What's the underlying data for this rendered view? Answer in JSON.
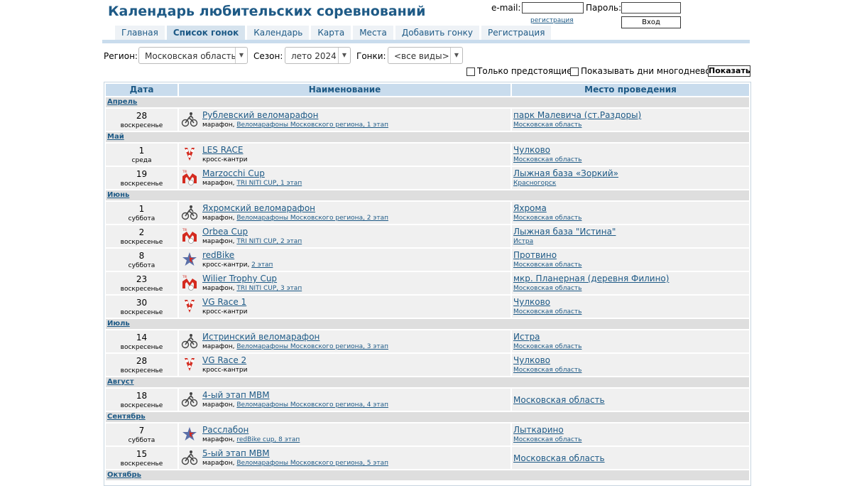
{
  "site": {
    "title": "Календарь любительских соревнований"
  },
  "login": {
    "email_label": "e-mail:",
    "password_label": "Пароль:",
    "register_link": "регистрация",
    "enter_button": "Вход"
  },
  "nav": {
    "tabs": [
      "Главная",
      "Список гонок",
      "Календарь",
      "Карта",
      "Места",
      "Добавить гонку",
      "Регистрация"
    ],
    "active": "Список гонок"
  },
  "filters": {
    "region_label": "Регион:",
    "region_value": "Московская область",
    "season_label": "Сезон:",
    "season_value": "лето 2024",
    "races_label": "Гонки:",
    "races_value": "<все виды>"
  },
  "options": {
    "upcoming_label": "Только предстоящие",
    "multiday_label": "Показывать дни многодневок",
    "show_button": "Показать"
  },
  "table": {
    "headers": {
      "date": "Дата",
      "name": "Наименование",
      "place": "Место проведения"
    },
    "months": [
      {
        "month": "Апрель",
        "races": [
          {
            "day": "28",
            "weekday": "воскресенье",
            "icon": "cyclist-icon",
            "name": "Рублевский веломарафон",
            "type": "марафон, ",
            "series": "Веломарафоны Московского региона, 1 этап",
            "place": "парк Малевича (ст.Раздоры)",
            "region": "Московская область"
          }
        ]
      },
      {
        "month": "Май",
        "races": [
          {
            "day": "1",
            "weekday": "среда",
            "icon": "vg-logo-icon",
            "name": "LES RACE",
            "type": "кросс-кантри",
            "series": "",
            "place": "Чулково",
            "region": "Московская область"
          },
          {
            "day": "19",
            "weekday": "воскресенье",
            "icon": "tri-niti-icon",
            "name": "Marzocchi Cup",
            "type": "марафон, ",
            "series": "TRI NITI CUP, 1 этап",
            "place": "Лыжная база «Зоркий»",
            "region": "Красногорск"
          }
        ]
      },
      {
        "month": "Июнь",
        "races": [
          {
            "day": "1",
            "weekday": "суббота",
            "icon": "cyclist-icon",
            "name": "Яхромский веломарафон",
            "type": "марафон, ",
            "series": "Веломарафоны Московского региона, 2 этап",
            "place": "Яхрома",
            "region": "Московская область"
          },
          {
            "day": "2",
            "weekday": "воскресенье",
            "icon": "tri-niti-icon",
            "name": "Orbea Cup",
            "type": "марафон, ",
            "series": "TRI NITI CUP, 2 этап",
            "place": "Лыжная база \"Истина\"",
            "region": "Истра"
          },
          {
            "day": "8",
            "weekday": "суббота",
            "icon": "redbike-star-icon",
            "name": "redBike",
            "type": "кросс-кантри, ",
            "series": "2 этап",
            "place": "Протвино",
            "region": "Московская область"
          },
          {
            "day": "23",
            "weekday": "воскресенье",
            "icon": "tri-niti-icon",
            "name": "Wilier Trophy Cup",
            "type": "марафон, ",
            "series": "TRI NITI CUP, 3 этап",
            "place": "мкр. Планерная (деревня Филино)",
            "region": "Московская область"
          },
          {
            "day": "30",
            "weekday": "воскресенье",
            "icon": "vg-logo-icon",
            "name": "VG Race 1",
            "type": "кросс-кантри",
            "series": "",
            "place": "Чулково",
            "region": "Московская область"
          }
        ]
      },
      {
        "month": "Июль",
        "races": [
          {
            "day": "14",
            "weekday": "воскресенье",
            "icon": "cyclist-icon",
            "name": "Истринский веломарафон",
            "type": "марафон, ",
            "series": "Веломарафоны Московского региона, 3 этап",
            "place": "Истра",
            "region": "Московская область"
          },
          {
            "day": "28",
            "weekday": "воскресенье",
            "icon": "vg-logo-icon",
            "name": "VG Race 2",
            "type": "кросс-кантри",
            "series": "",
            "place": "Чулково",
            "region": "Московская область"
          }
        ]
      },
      {
        "month": "Август",
        "races": [
          {
            "day": "18",
            "weekday": "воскресенье",
            "icon": "cyclist-icon",
            "name": "4-ый этап МВМ",
            "type": "марафон, ",
            "series": "Веломарафоны Московского региона, 4 этап",
            "place": "Московская область",
            "region": ""
          }
        ]
      },
      {
        "month": "Сентябрь",
        "races": [
          {
            "day": "7",
            "weekday": "суббота",
            "icon": "redbike-star-icon",
            "name": "Расслабон",
            "type": "марафон, ",
            "series": "redBike cup, 8 этап",
            "place": "Лыткарино",
            "region": "Московская область"
          },
          {
            "day": "15",
            "weekday": "воскресенье",
            "icon": "cyclist-icon",
            "name": "5-ый этап МВМ",
            "type": "марафон, ",
            "series": "Веломарафоны Московского региона, 5 этап",
            "place": "Московская область",
            "region": ""
          }
        ]
      },
      {
        "month": "Октябрь",
        "races": []
      }
    ]
  }
}
